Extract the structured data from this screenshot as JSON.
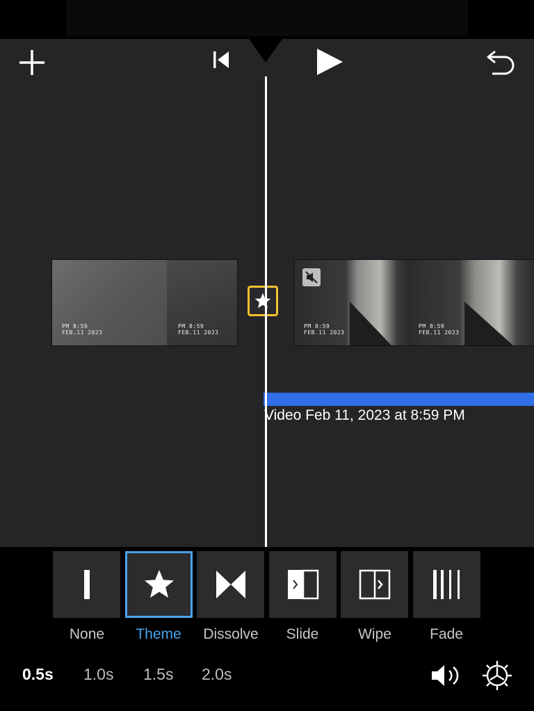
{
  "toolbar": {
    "add_icon": "plus-icon",
    "rewind_icon": "skip-to-start-icon",
    "play_icon": "play-icon",
    "undo_icon": "undo-icon"
  },
  "timeline": {
    "clip1_stamps": [
      {
        "line1": "PM  8:59",
        "line2": "FEB.11 2023"
      },
      {
        "line1": "PM  8:59",
        "line2": "FEB.11 2023"
      }
    ],
    "clip2_stamps": [
      {
        "line1": "PM  8:59",
        "line2": "FEB.11 2023"
      },
      {
        "line1": "PM  8:59",
        "line2": "FEB.11 2023"
      }
    ],
    "transition_icon": "star-icon",
    "clip2_audio_icon": "muted-speaker-icon",
    "clip_title": "Video Feb 11, 2023 at 8:59 PM"
  },
  "transitions": [
    {
      "label": "None",
      "icon": "none-transition-icon",
      "selected": false
    },
    {
      "label": "Theme",
      "icon": "star-icon",
      "selected": true
    },
    {
      "label": "Dissolve",
      "icon": "dissolve-icon",
      "selected": false
    },
    {
      "label": "Slide",
      "icon": "slide-icon",
      "selected": false
    },
    {
      "label": "Wipe",
      "icon": "wipe-icon",
      "selected": false
    },
    {
      "label": "Fade",
      "icon": "fade-icon",
      "selected": false
    }
  ],
  "durations": [
    {
      "label": "0.5s",
      "active": true
    },
    {
      "label": "1.0s",
      "active": false
    },
    {
      "label": "1.5s",
      "active": false
    },
    {
      "label": "2.0s",
      "active": false
    }
  ],
  "bottom_icons": {
    "sound": "speaker-icon",
    "settings": "gear-icon"
  },
  "colors": {
    "accent": "#4aa3ea",
    "selection_yellow": "#f3c02e",
    "clip_bar": "#2f6fe8"
  }
}
